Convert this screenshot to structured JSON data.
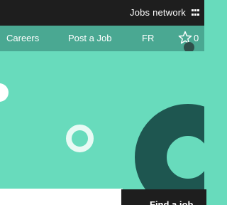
{
  "topbar": {
    "network_label": "Jobs network",
    "apps_icon": "grid-icon"
  },
  "nav": {
    "items": [
      {
        "label": "Careers"
      },
      {
        "label": "Post a Job"
      },
      {
        "label": "FR"
      }
    ],
    "favorites_icon": "star-icon",
    "favorites_count": "0"
  },
  "search": {
    "button_label": "Find a job"
  },
  "colors": {
    "topbar_bg": "#1e1e1e",
    "nav_bg": "#4aa892",
    "hero_bg": "#68dbbc",
    "ring_dark": "#1e5650"
  }
}
